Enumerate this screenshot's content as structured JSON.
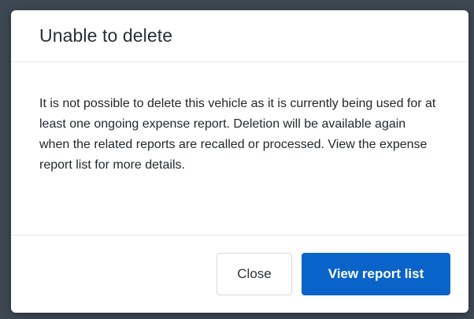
{
  "dialog": {
    "title": "Unable to delete",
    "message": "It is not possible to delete this vehicle as it is currently being used for at least one ongoing expense report. Deletion will be available again when the related reports are recalled or processed. View the expense report list for more details.",
    "close_label": "Close",
    "primary_label": "View report list"
  },
  "colors": {
    "primary": "#0a63c9",
    "backdrop": "#3d4852"
  }
}
